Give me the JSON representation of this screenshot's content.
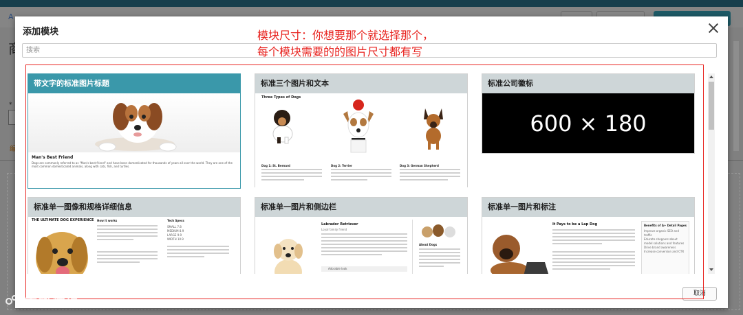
{
  "background": {
    "page_title": "商",
    "crumb": "A",
    "orange_hint": "编"
  },
  "modal": {
    "title": "添加模块",
    "search_placeholder": "搜索",
    "cancel_label": "取消"
  },
  "annotation": {
    "line1": "模块尺寸：你想要那个就选择那个，",
    "line2": "每个模块需要的的图片尺寸都有写"
  },
  "cards": [
    {
      "title": "带文字的标准图片标题",
      "selected": true,
      "caption_title": "Man's Best Friend",
      "caption_text": "Dogs are commonly referred to as \"Man's best friend\" and have been domesticated for thousands of years all over the world. They are one of the most common domesticated animals, along with cats, fish, and turtles."
    },
    {
      "title": "标准三个图片和文本",
      "heading": "Three Types of Dogs",
      "labels": [
        "Dog 1: St. Bernard",
        "Dog 2: Terrier",
        "Dog 3: German Shepherd"
      ]
    },
    {
      "title": "标准公司徽标",
      "placeholder": "600 × 180"
    },
    {
      "title": "标准单一图像和规格详细信息",
      "heading": "THE ULTIMATE DOG EXPERIENCE",
      "col1_title": "How it works",
      "col2_title": "Tech Specs",
      "specs": [
        "SMALL  7.8",
        "MEDIUM  8.9",
        "LARGE  9.9",
        "WIDTH  10.9"
      ]
    },
    {
      "title": "标准单一图片和侧边栏",
      "heading": "Labrador Retriever",
      "sub": "Loyal family friend",
      "sidebar_label": "About Dogs",
      "check_item": "Adorable look"
    },
    {
      "title": "标准单一图片和标注",
      "heading": "It Pays to be a Lap Dog",
      "callout_title": "Benefits of A+ Detail Pages",
      "callout_items": [
        "Improve organic SEO and traffic",
        "Educate shoppers about model solutions and features",
        "Drive brand awareness",
        "Increase conversion and CTR"
      ]
    }
  ],
  "watermark": "大数跨境",
  "colors": {
    "accent": "#3a98aa",
    "annotation_red": "#e8231f",
    "card_header": "#ced6d8",
    "top_bar": "#163e4c"
  },
  "icons": [
    "close-icon",
    "scroll-up-icon",
    "scroll-down-icon",
    "watermark-logo-icon"
  ]
}
